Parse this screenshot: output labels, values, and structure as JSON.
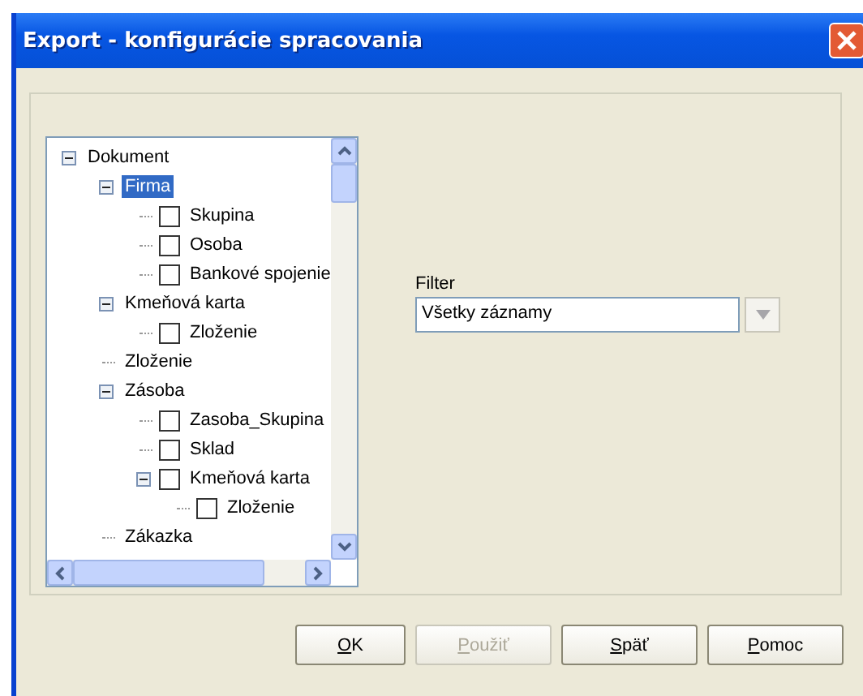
{
  "window": {
    "title": "Export - konfigurácie spracovania"
  },
  "tree": [
    {
      "label": "Dokument",
      "selected": false,
      "expanded": true,
      "children": [
        {
          "label": "Firma",
          "selected": true,
          "expanded": true,
          "children": [
            {
              "label": "Skupina",
              "selected": false,
              "checked": false
            },
            {
              "label": "Osoba",
              "selected": false,
              "checked": false
            },
            {
              "label": "Bankové spojenie",
              "selected": false,
              "checked": false
            }
          ]
        },
        {
          "label": "Kmeňová karta",
          "selected": false,
          "expanded": true,
          "children": [
            {
              "label": "Zloženie",
              "selected": false,
              "checked": false
            }
          ]
        },
        {
          "label": "Zloženie",
          "selected": false
        },
        {
          "label": "Zásoba",
          "selected": false,
          "expanded": true,
          "children": [
            {
              "label": "Zasoba_Skupina",
              "selected": false,
              "checked": false
            },
            {
              "label": "Sklad",
              "selected": false,
              "checked": false
            },
            {
              "label": "Kmeňová karta",
              "selected": false,
              "checked": false,
              "expanded": true,
              "children": [
                {
                  "label": "Zloženie",
                  "selected": false,
                  "checked": false
                }
              ]
            }
          ]
        },
        {
          "label": "Zákazka",
          "selected": false
        }
      ]
    }
  ],
  "filter": {
    "label": "Filter",
    "value": "Všetky záznamy"
  },
  "buttons": [
    {
      "label": "OK",
      "disabled": false
    },
    {
      "label": "Použiť",
      "disabled": true
    },
    {
      "label": "Späť",
      "disabled": false
    },
    {
      "label": "Pomoc",
      "disabled": false
    }
  ]
}
